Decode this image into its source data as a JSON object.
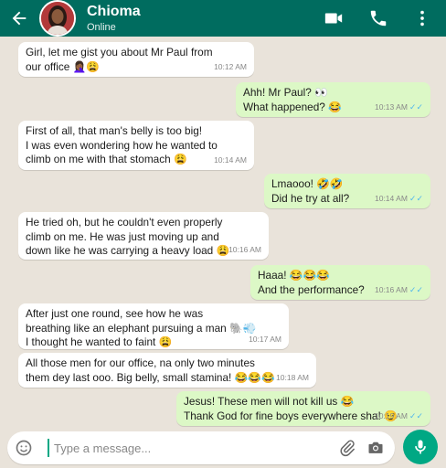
{
  "header": {
    "contact_name": "Chioma",
    "status": "Online",
    "icons": [
      "back-arrow-icon",
      "video-call-icon",
      "phone-icon",
      "more-options-icon"
    ]
  },
  "messages": [
    {
      "dir": "in",
      "text": "Girl, let me gist you about Mr Paul from\nour office",
      "emoji": "🤦🏾‍♀️😩",
      "time": "10:12 AM"
    },
    {
      "dir": "out",
      "text": "Ahh! Mr Paul? 👀\nWhat happened?",
      "emoji": "😂",
      "time": "10:13 AM"
    },
    {
      "dir": "in",
      "text": "First of all, that man's belly is too big!\nI was even wondering how he wanted to\nclimb on me with that stomach",
      "emoji": "😩",
      "time": "10:14 AM"
    },
    {
      "dir": "out",
      "text": "Lmaooo! 🤣🤣\nDid he try at all?",
      "emoji": "",
      "time": "10:14 AM"
    },
    {
      "dir": "in",
      "text": "He tried oh, but he couldn't even properly\nclimb on me. He was just moving up and\ndown like he was carrying a heavy load",
      "emoji": "😩",
      "time": "10:16 AM"
    },
    {
      "dir": "out",
      "text": "Haaa! 😂😂😂\nAnd the performance?",
      "emoji": "",
      "time": "10:16 AM"
    },
    {
      "dir": "in",
      "text": "After just one round, see how he was\nbreathing like an elephant pursuing a man 🐘💨\nI thought he wanted to faint",
      "emoji": "😩",
      "time": "10:17 AM"
    },
    {
      "dir": "in",
      "text": "All those men for our office, na only two minutes\nthem dey last ooo. Big belly, small stamina!",
      "emoji": "😂😂😂",
      "time": "10:18 AM"
    },
    {
      "dir": "out",
      "text": "Jesus! These men will not kill us 😂\nThank God for fine boys everywhere sha!",
      "emoji": "😏",
      "time": "10:19 AM"
    }
  ],
  "composer": {
    "placeholder": "Type a message...",
    "icons": [
      "emoji-icon",
      "attach-icon",
      "camera-icon",
      "microphone-icon"
    ]
  },
  "colors": {
    "header": "#006c5f",
    "incoming_bubble": "#ffffff",
    "outgoing_bubble": "#dcf8c6",
    "chat_bg": "#e9e3da",
    "accent": "#00a884",
    "read_ticks": "#4fb6ec"
  }
}
